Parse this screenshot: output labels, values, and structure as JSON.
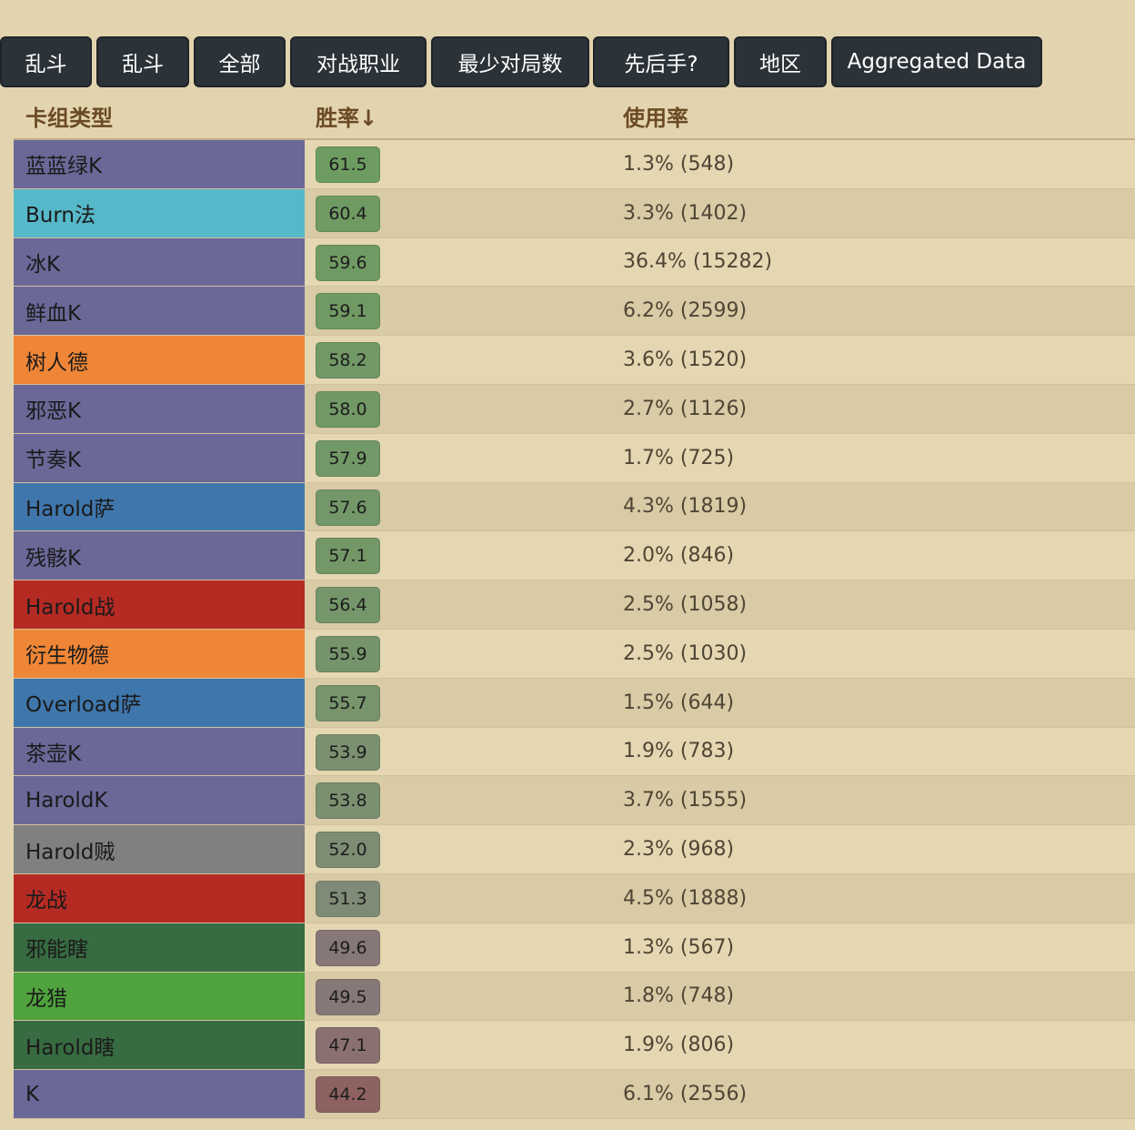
{
  "toolbar": {
    "buttons": [
      {
        "label": "乱斗"
      },
      {
        "label": "乱斗"
      },
      {
        "label": "全部"
      },
      {
        "label": "对战职业"
      },
      {
        "label": "最少对局数"
      },
      {
        "label": "先后手?"
      },
      {
        "label": "地区"
      },
      {
        "label": "Aggregated Data"
      }
    ]
  },
  "table": {
    "headers": {
      "deck": "卡组类型",
      "winrate": "胜率↓",
      "usage": "使用率"
    },
    "rows": [
      {
        "deck": "蓝蓝绿K",
        "class_color": "#6b6898",
        "winrate": "61.5",
        "winrate_color": "#6e9c60",
        "usage": "1.3% (548)"
      },
      {
        "deck": "Burn法",
        "class_color": "#56b8c8",
        "winrate": "60.4",
        "winrate_color": "#6f9a62",
        "usage": "3.3% (1402)"
      },
      {
        "deck": "冰K",
        "class_color": "#6b6898",
        "winrate": "59.6",
        "winrate_color": "#709a63",
        "usage": "36.4% (15282)"
      },
      {
        "deck": "鲜血K",
        "class_color": "#6b6898",
        "winrate": "59.1",
        "winrate_color": "#709963",
        "usage": "6.2% (2599)"
      },
      {
        "deck": "树人德",
        "class_color": "#ef8637",
        "winrate": "58.2",
        "winrate_color": "#729866",
        "usage": "3.6% (1520)"
      },
      {
        "deck": "邪恶K",
        "class_color": "#6b6898",
        "winrate": "58.0",
        "winrate_color": "#729866",
        "usage": "2.7% (1126)"
      },
      {
        "deck": "节奏K",
        "class_color": "#6b6898",
        "winrate": "57.9",
        "winrate_color": "#729867",
        "usage": "1.7% (725)"
      },
      {
        "deck": "Harold萨",
        "class_color": "#3f77ad",
        "winrate": "57.6",
        "winrate_color": "#739768",
        "usage": "4.3% (1819)"
      },
      {
        "deck": "残骸K",
        "class_color": "#6b6898",
        "winrate": "57.1",
        "winrate_color": "#749768",
        "usage": "2.0% (846)"
      },
      {
        "deck": "Harold战",
        "class_color": "#b52b24",
        "winrate": "56.4",
        "winrate_color": "#75956a",
        "usage": "2.5% (1058)"
      },
      {
        "deck": "衍生物德",
        "class_color": "#ef8637",
        "winrate": "55.9",
        "winrate_color": "#76946b",
        "usage": "2.5% (1030)"
      },
      {
        "deck": "Overload萨",
        "class_color": "#3f77ad",
        "winrate": "55.7",
        "winrate_color": "#77946c",
        "usage": "1.5% (644)"
      },
      {
        "deck": "茶壶K",
        "class_color": "#6b6898",
        "winrate": "53.9",
        "winrate_color": "#7a9070",
        "usage": "1.9% (783)"
      },
      {
        "deck": "HaroldK",
        "class_color": "#6b6898",
        "winrate": "53.8",
        "winrate_color": "#7a9070",
        "usage": "3.7% (1555)"
      },
      {
        "deck": "Harold贼",
        "class_color": "#808080",
        "winrate": "52.0",
        "winrate_color": "#7d8d74",
        "usage": "2.3% (968)"
      },
      {
        "deck": "龙战",
        "class_color": "#b52b24",
        "winrate": "51.3",
        "winrate_color": "#7f8b76",
        "usage": "4.5% (1888)"
      },
      {
        "deck": "邪能瞎",
        "class_color": "#376b41",
        "winrate": "49.6",
        "winrate_color": "#877878",
        "usage": "1.3% (567)"
      },
      {
        "deck": "龙猎",
        "class_color": "#4fa23d",
        "winrate": "49.5",
        "winrate_color": "#877878",
        "usage": "1.8% (748)"
      },
      {
        "deck": "Harold瞎",
        "class_color": "#376b41",
        "winrate": "47.1",
        "winrate_color": "#8a7070",
        "usage": "1.9% (806)"
      },
      {
        "deck": "K",
        "class_color": "#6b6898",
        "winrate": "44.2",
        "winrate_color": "#8f6262",
        "usage": "6.1% (2556)"
      }
    ]
  }
}
